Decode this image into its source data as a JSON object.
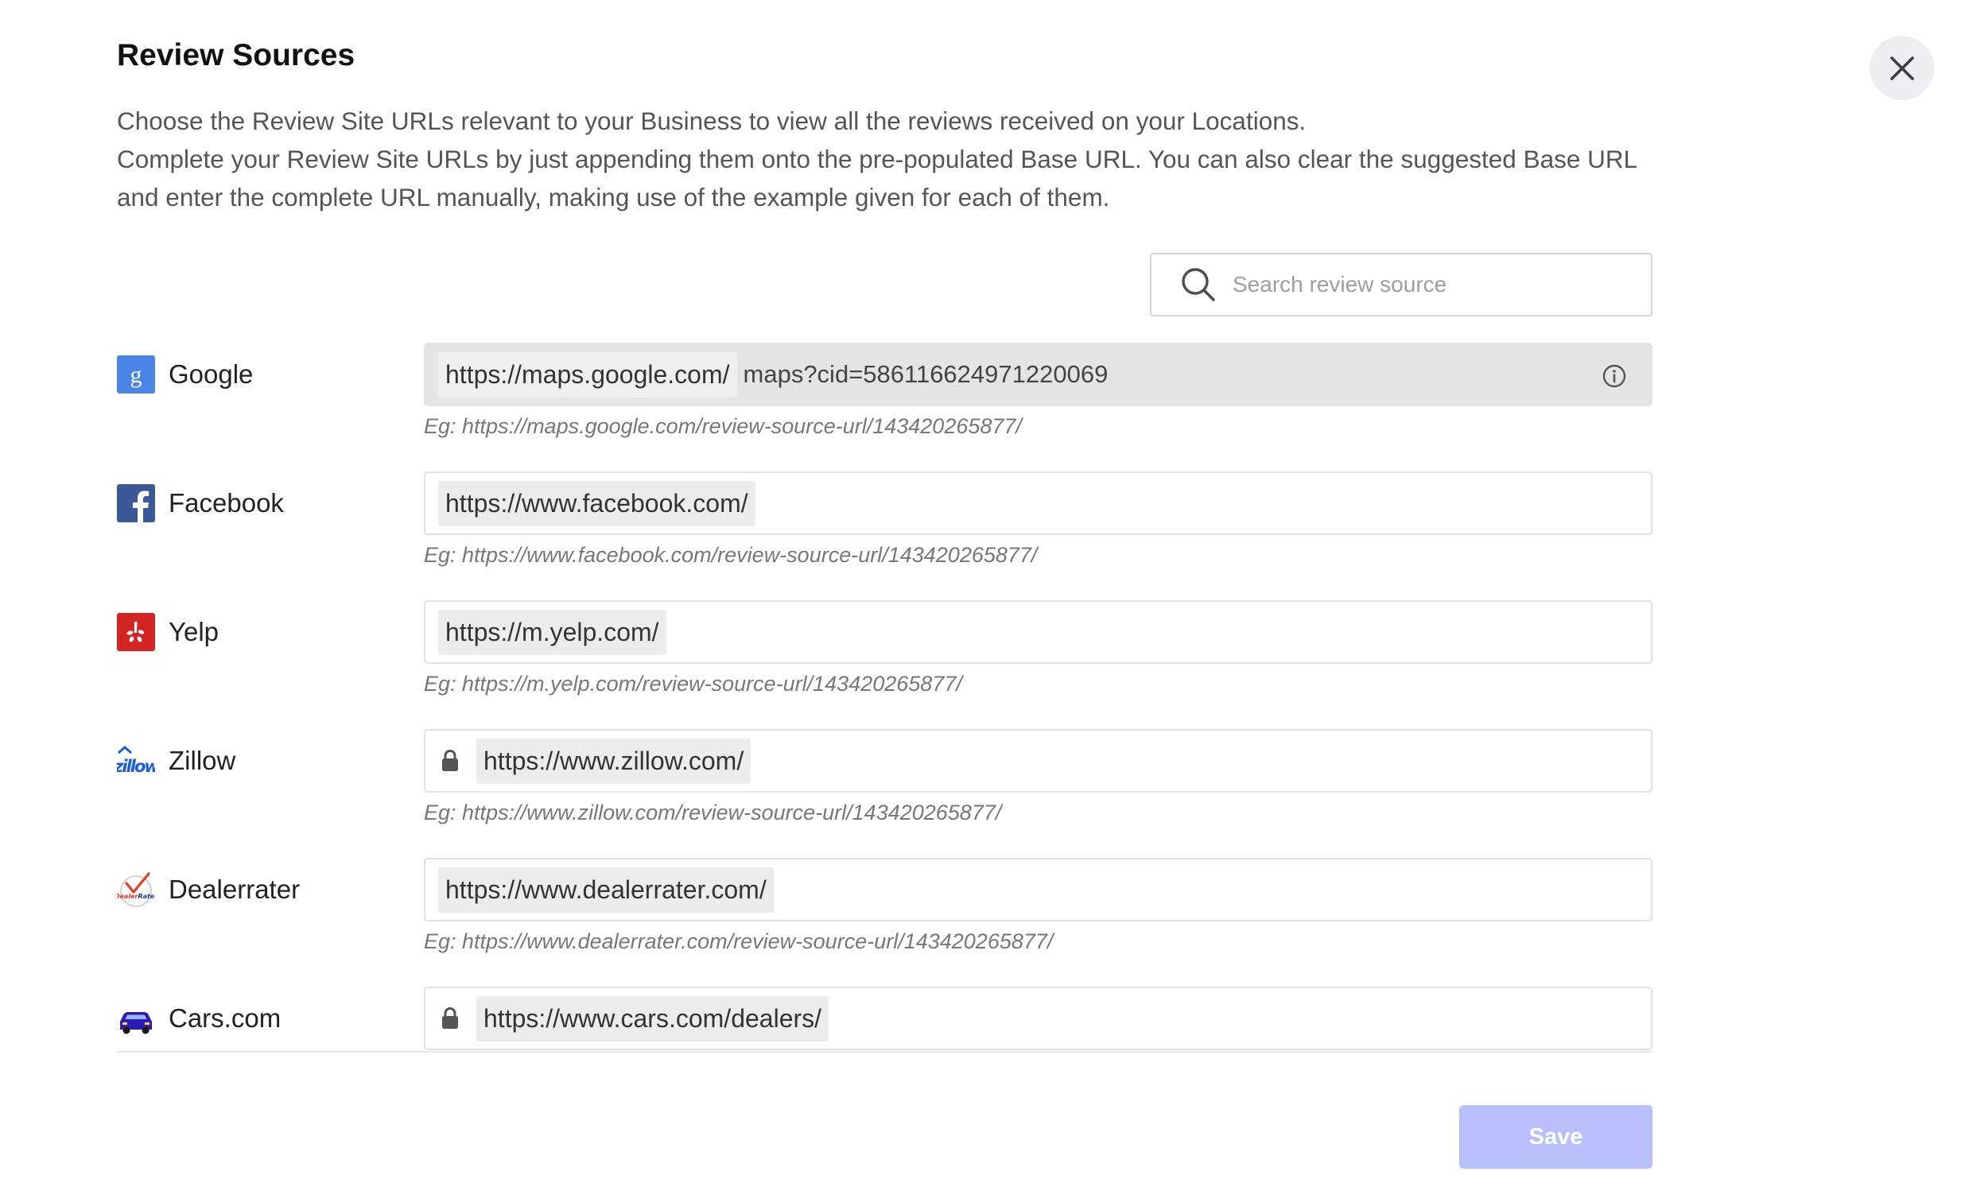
{
  "header": {
    "title": "Review Sources",
    "description_line1": "Choose the Review Site URLs relevant to your Business to view all the reviews received on your Locations.",
    "description_line2": "Complete your Review Site URLs by just appending them onto the pre-populated Base URL. You can also clear the suggested Base URL and enter the complete URL manually, making use of the example given for each of them.",
    "close_icon": "close-icon"
  },
  "search": {
    "placeholder": "Search review source",
    "value": "",
    "icon": "search-icon"
  },
  "sources": [
    {
      "name": "Google",
      "icon": "google-icon",
      "base_url": "https://maps.google.com/",
      "value": "maps?cid=586116624971220069",
      "example": "Eg: https://maps.google.com/review-source-url/143420265877/",
      "locked": false,
      "active": true,
      "info_icon": "info-icon"
    },
    {
      "name": "Facebook",
      "icon": "facebook-icon",
      "base_url": "https://www.facebook.com/",
      "value": "",
      "example": "Eg: https://www.facebook.com/review-source-url/143420265877/",
      "locked": false
    },
    {
      "name": "Yelp",
      "icon": "yelp-icon",
      "base_url": "https://m.yelp.com/",
      "value": "",
      "example": "Eg: https://m.yelp.com/review-source-url/143420265877/",
      "locked": false
    },
    {
      "name": "Zillow",
      "icon": "zillow-icon",
      "base_url": "https://www.zillow.com/",
      "value": "",
      "example": "Eg: https://www.zillow.com/review-source-url/143420265877/",
      "locked": true
    },
    {
      "name": "Dealerrater",
      "icon": "dealerrater-icon",
      "logo_text": "DealerRater",
      "base_url": "https://www.dealerrater.com/",
      "value": "",
      "example": "Eg: https://www.dealerrater.com/review-source-url/143420265877/",
      "locked": false
    },
    {
      "name": "Cars.com",
      "icon": "car-icon",
      "base_url": "https://www.cars.com/dealers/",
      "value": "",
      "example": "",
      "locked": true
    }
  ],
  "footer": {
    "save_label": "Save",
    "save_enabled": false
  },
  "colors": {
    "google": "#4a86e8",
    "facebook": "#3b5998",
    "yelp": "#d32323",
    "zillow": "#1a5ed8",
    "cars": "#2b1bb8",
    "save_button": "#b8bffb"
  }
}
